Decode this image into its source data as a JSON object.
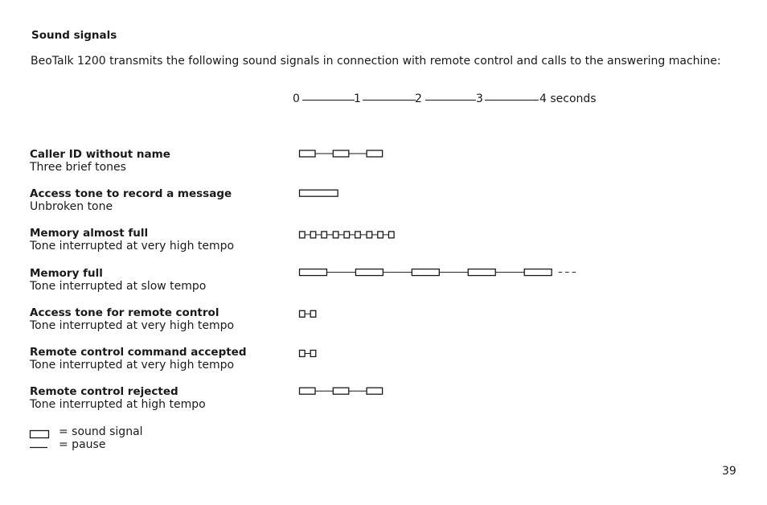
{
  "heading": "Sound signals",
  "intro": "BeoTalk 1200 transmits the following sound signals in connection with remote control and calls to the answering machine:",
  "timescale": {
    "ticks": [
      "0",
      "1",
      "2",
      "3"
    ],
    "last_tick": "4 seconds",
    "max_seconds": 4
  },
  "signals": [
    {
      "title": "Caller ID without name",
      "desc": "Three brief tones",
      "pattern": [
        [
          0.0,
          0.27
        ],
        [
          0.55,
          0.82
        ],
        [
          1.1,
          1.37
        ]
      ],
      "continues": false
    },
    {
      "title": "Access tone to record a message",
      "desc": "Unbroken tone",
      "pattern": [
        [
          0.0,
          0.64
        ]
      ],
      "continues": false
    },
    {
      "title": "Memory almost full",
      "desc": "Tone interrupted at very high tempo",
      "pattern": [
        [
          0.0,
          0.1
        ],
        [
          0.18,
          0.28
        ],
        [
          0.36,
          0.46
        ],
        [
          0.55,
          0.65
        ],
        [
          0.73,
          0.83
        ],
        [
          0.91,
          1.01
        ],
        [
          1.1,
          1.2
        ],
        [
          1.28,
          1.38
        ],
        [
          1.46,
          1.56
        ]
      ],
      "continues": false
    },
    {
      "title": "Memory full",
      "desc": "Tone interrupted at slow tempo",
      "pattern": [
        [
          0.0,
          0.46
        ],
        [
          0.92,
          1.38
        ],
        [
          1.84,
          2.3
        ],
        [
          2.76,
          3.22
        ],
        [
          3.68,
          4.14
        ]
      ],
      "continues": true
    },
    {
      "title": "Access tone for remote control",
      "desc": "Tone interrupted at very high tempo",
      "pattern": [
        [
          0.0,
          0.1
        ],
        [
          0.18,
          0.28
        ]
      ],
      "continues": false
    },
    {
      "title": "Remote control command accepted",
      "desc": "Tone interrupted at very high tempo",
      "pattern": [
        [
          0.0,
          0.1
        ],
        [
          0.18,
          0.28
        ]
      ],
      "continues": false
    },
    {
      "title": "Remote control rejected",
      "desc": "Tone interrupted at high tempo",
      "pattern": [
        [
          0.0,
          0.27
        ],
        [
          0.55,
          0.82
        ],
        [
          1.1,
          1.37
        ]
      ],
      "continues": false
    }
  ],
  "legend": {
    "signal_label": "= sound signal",
    "pause_label": "= pause"
  },
  "page_number": "39"
}
